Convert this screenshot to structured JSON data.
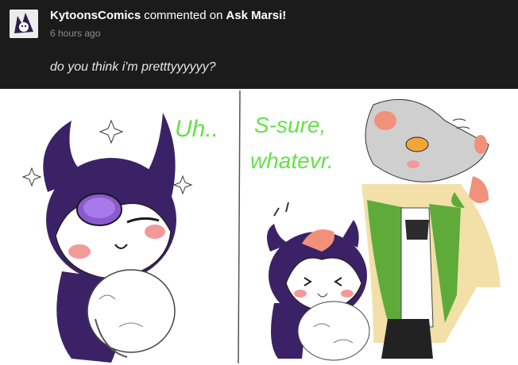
{
  "notification": {
    "username": "KytoonsComics",
    "action": "commented on",
    "post_title": "Ask Marsi!",
    "timestamp": "6 hours ago",
    "comment": "do you think i'm pretttyyyyyy?"
  },
  "comic": {
    "left_speech": "Uh..",
    "right_speech_line1": "S-sure,",
    "right_speech_line2": "whatevr."
  },
  "colors": {
    "header_bg": "#1b1b1b",
    "speech_green": "#66e04a",
    "character_purple": "#3b2266"
  }
}
